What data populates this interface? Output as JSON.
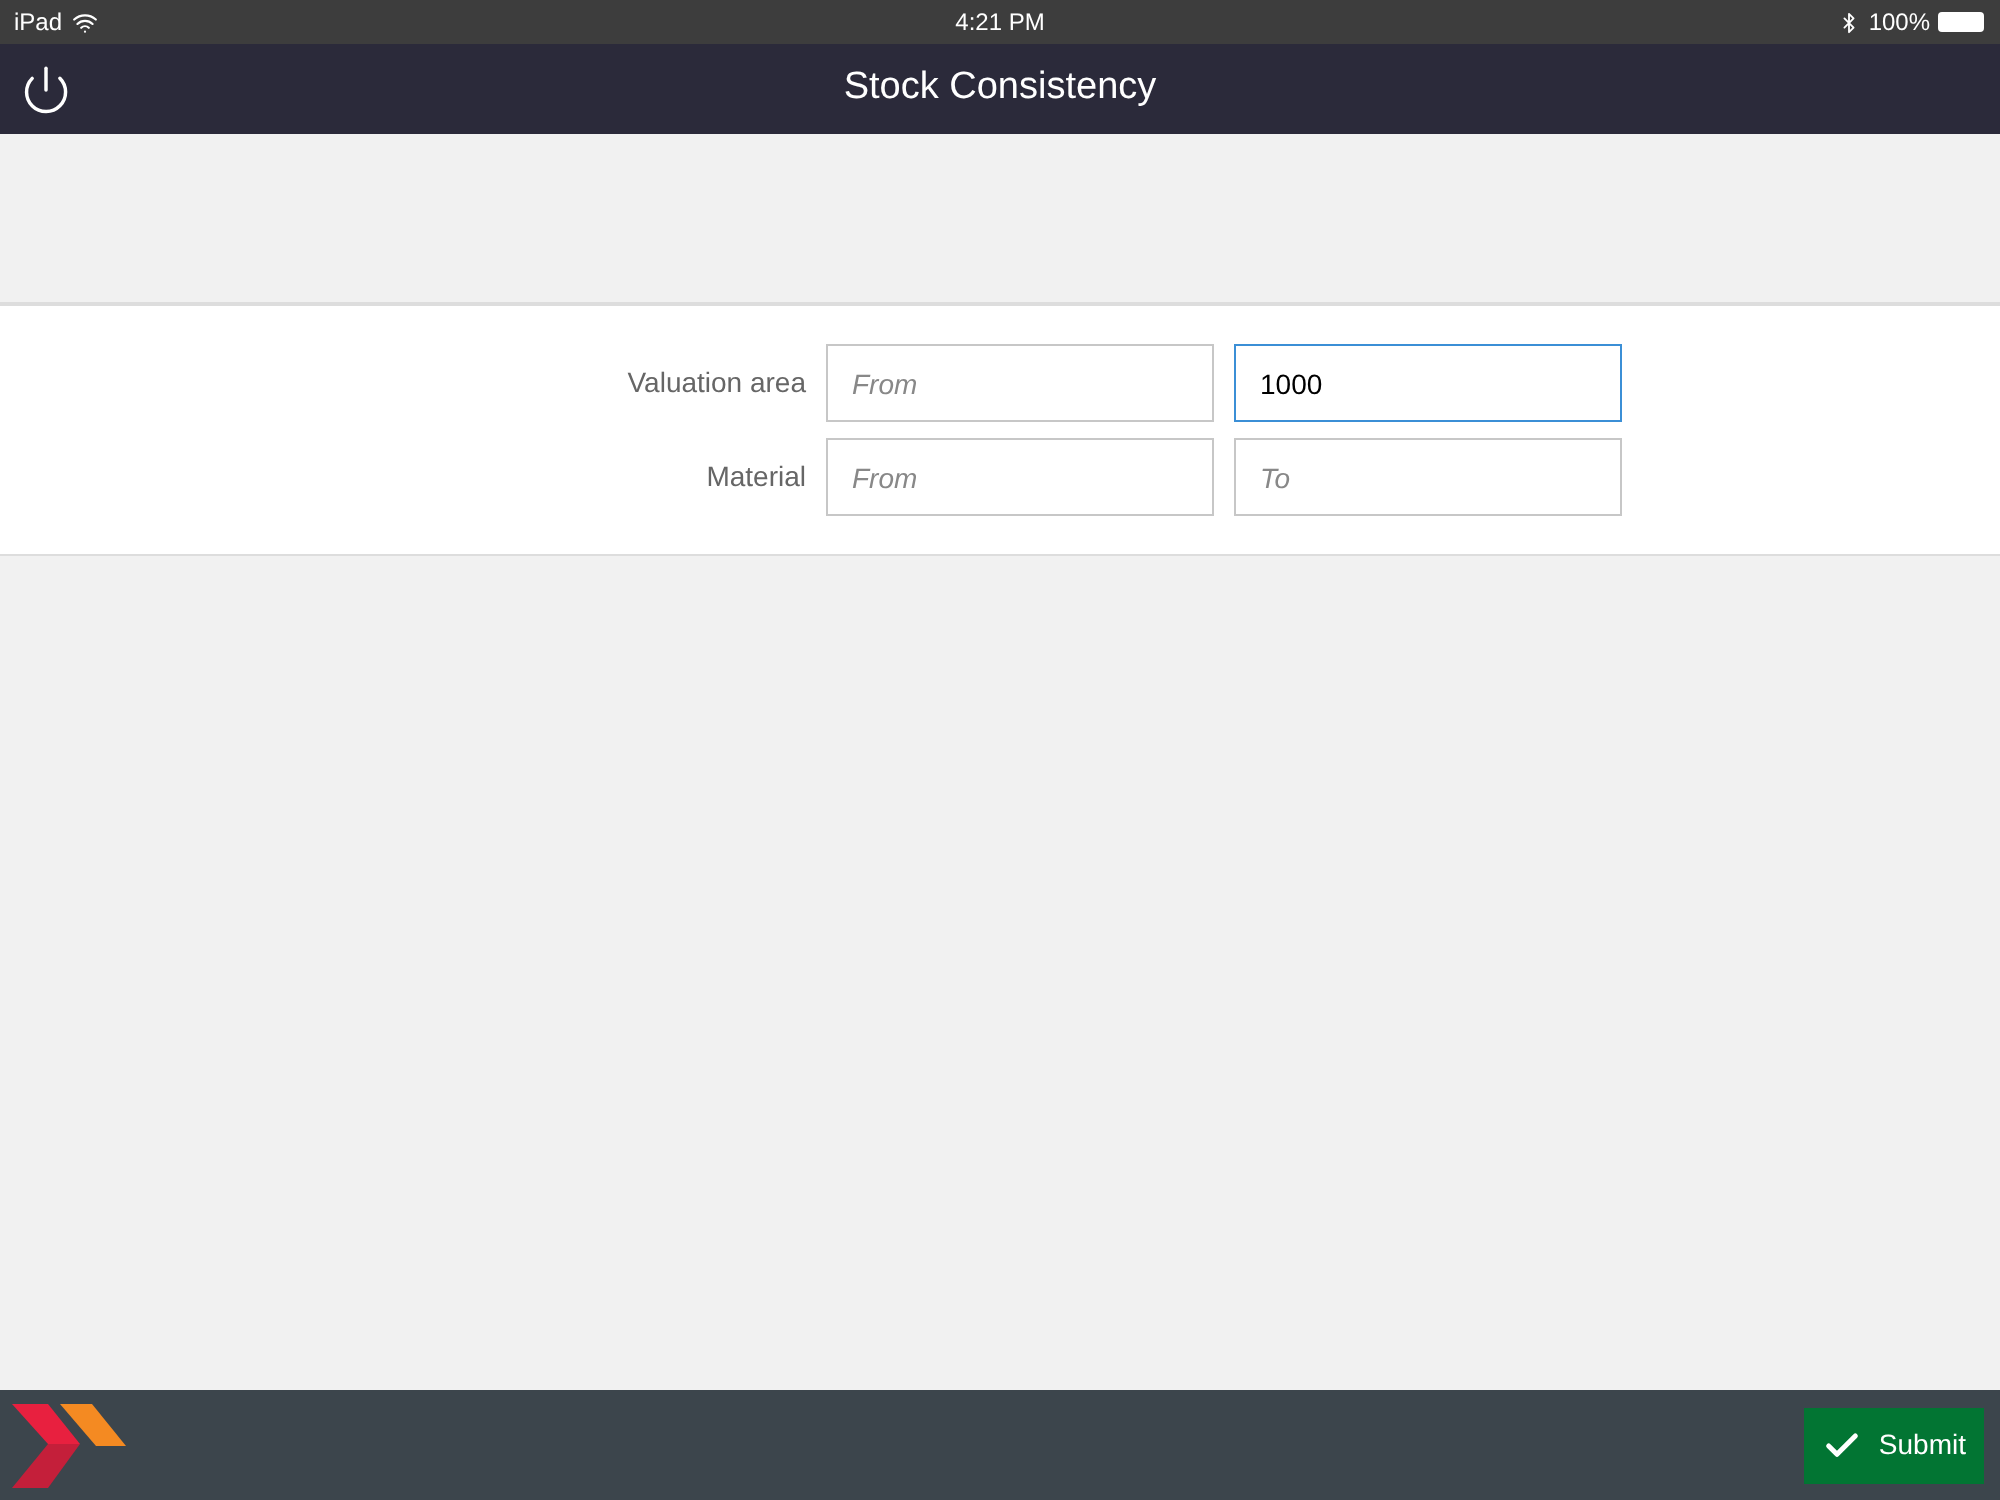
{
  "status_bar": {
    "device": "iPad",
    "time": "4:21 PM",
    "battery": "100%"
  },
  "header": {
    "title": "Stock Consistency"
  },
  "form": {
    "rows": [
      {
        "label": "Valuation area",
        "fields": [
          {
            "placeholder": "From",
            "focused": false
          },
          {
            "value": "1000",
            "focused": true
          }
        ]
      },
      {
        "label": "Material",
        "fields": [
          {
            "placeholder": "From",
            "focused": false
          },
          {
            "placeholder": "To",
            "focused": false
          }
        ]
      }
    ]
  },
  "footer": {
    "submit": "Submit"
  }
}
